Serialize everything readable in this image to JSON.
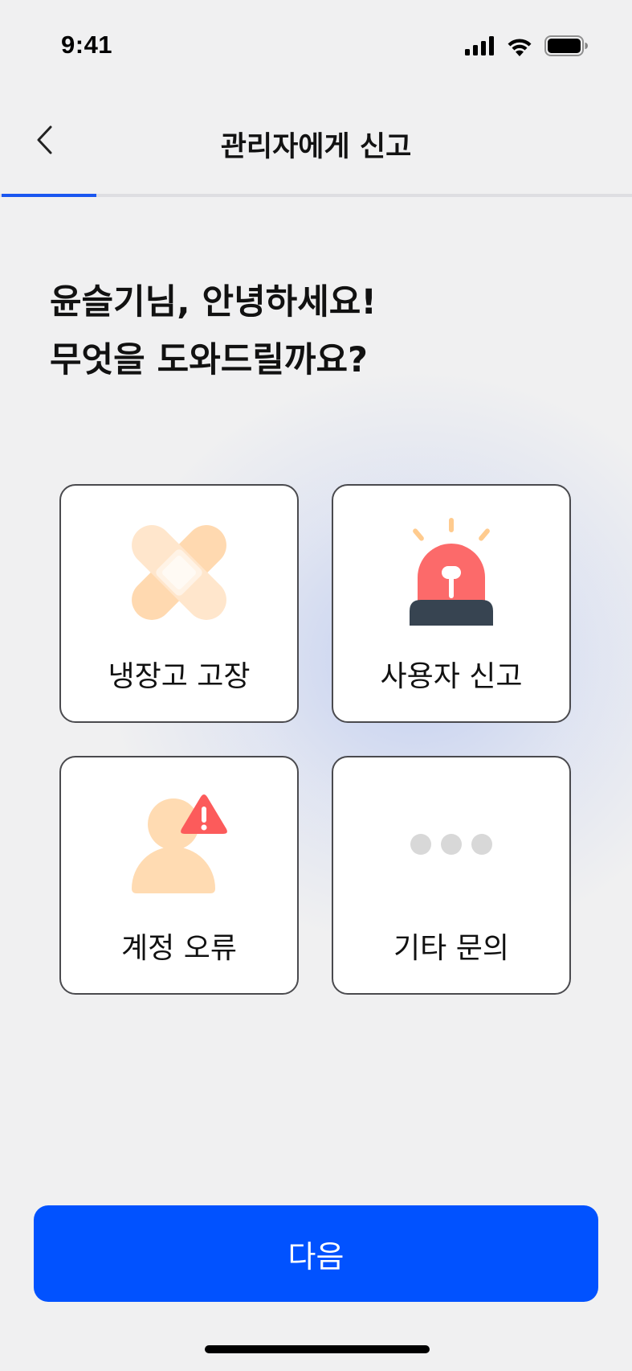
{
  "status_bar": {
    "time": "9:41",
    "icons": [
      "signal-icon",
      "wifi-icon",
      "battery-icon"
    ]
  },
  "header": {
    "back_icon": "chevron-left-icon",
    "title": "관리자에게 신고"
  },
  "progress": {
    "fraction": 0.15,
    "colors": {
      "fill": "#1a56f0",
      "track": "#dedee2"
    }
  },
  "greeting": {
    "line1": "윤슬기님, 안녕하세요!",
    "line2": "무엇을 도와드릴까요?"
  },
  "options": [
    {
      "label": "냉장고 고장",
      "icon": "bandage-icon"
    },
    {
      "label": "사용자 신고",
      "icon": "siren-icon"
    },
    {
      "label": "계정 오류",
      "icon": "user-warning-icon"
    },
    {
      "label": "기타 문의",
      "icon": "more-dots-icon"
    }
  ],
  "footer": {
    "next_label": "다음",
    "accent_color": "#0152ff"
  }
}
